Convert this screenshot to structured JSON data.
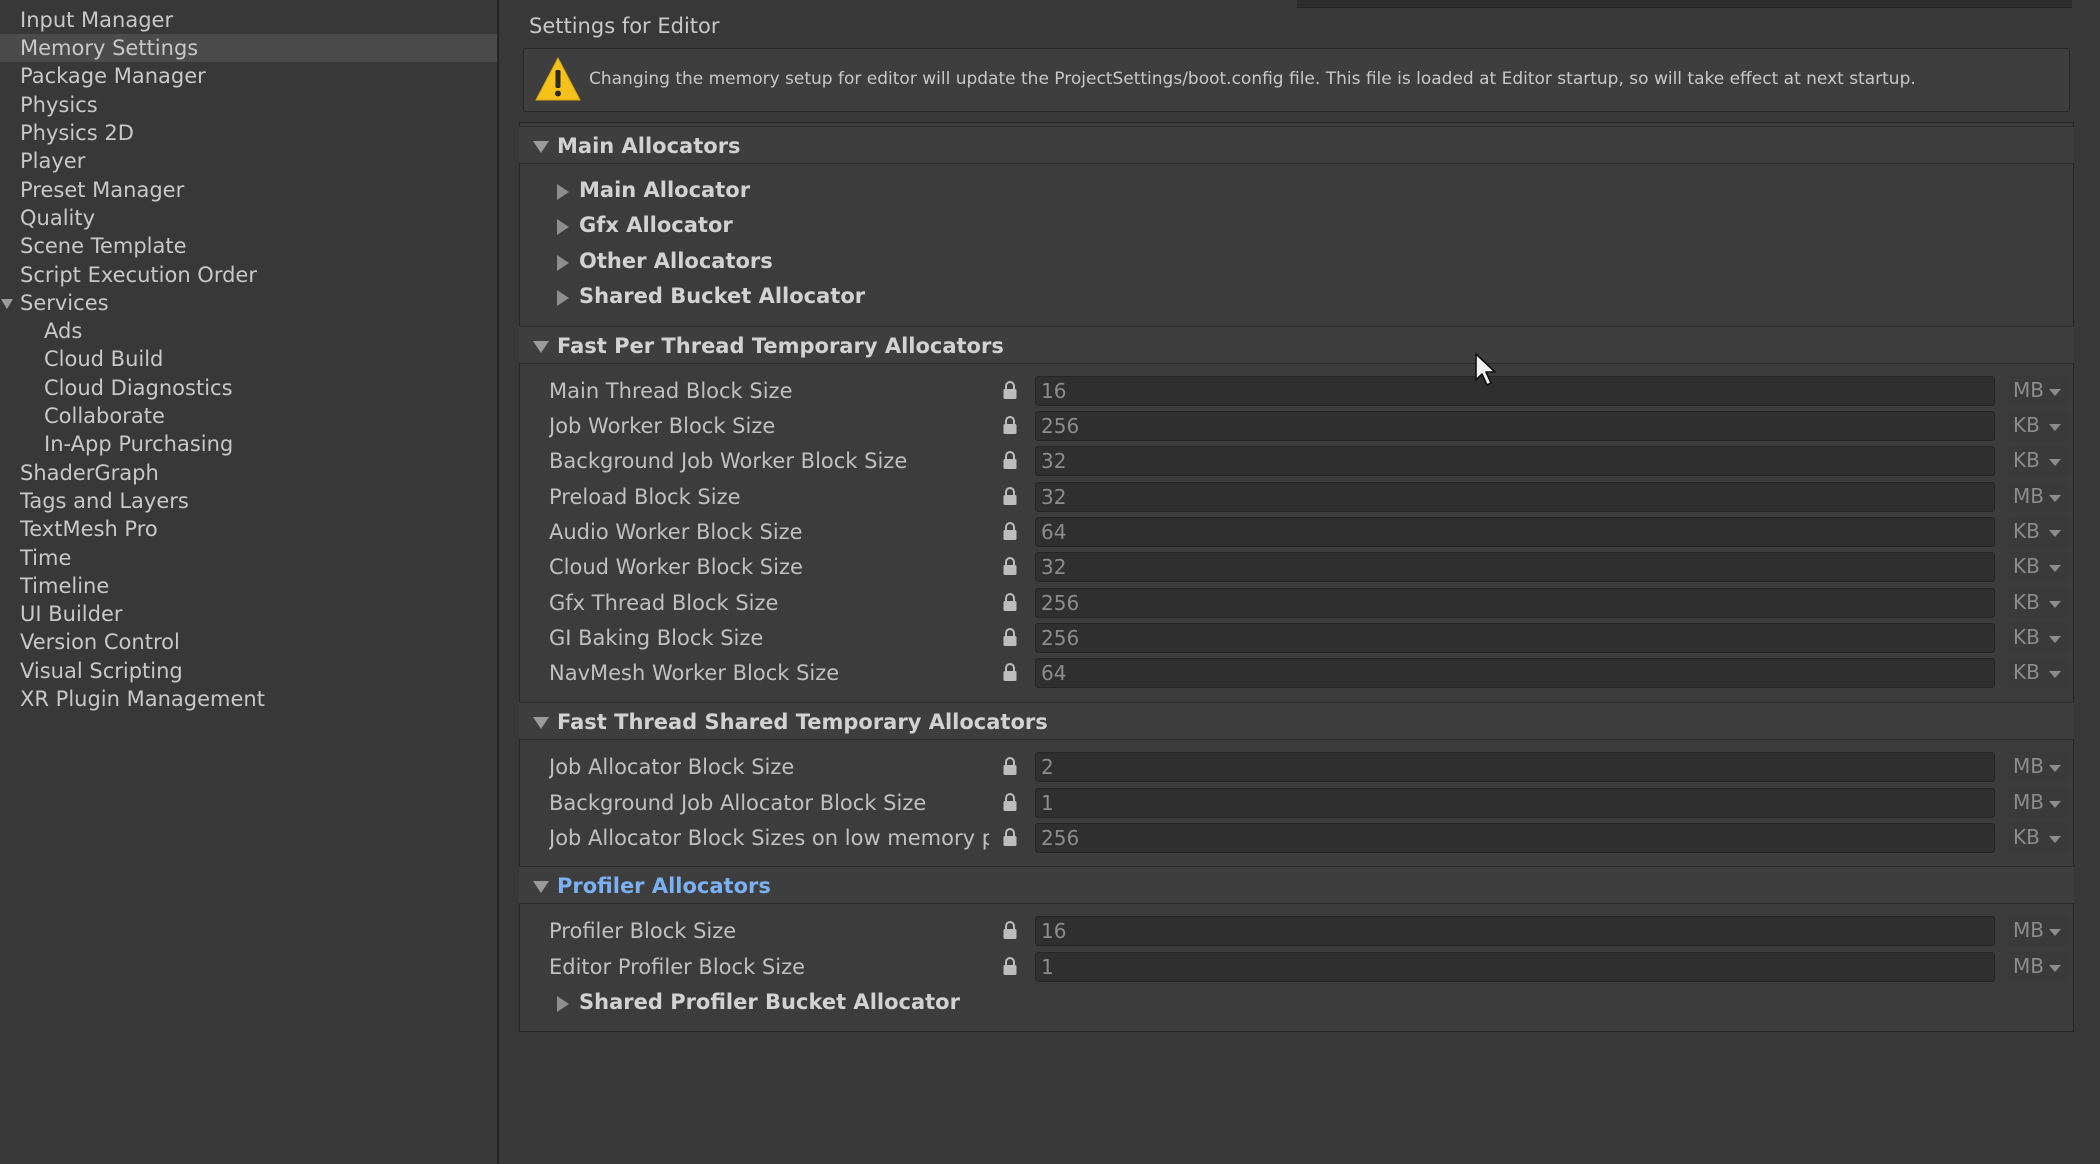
{
  "sidebar": {
    "selected": "Memory Settings",
    "items": [
      {
        "label": "Input Manager",
        "level": 0
      },
      {
        "label": "Memory Settings",
        "level": 0
      },
      {
        "label": "Package Manager",
        "level": 0
      },
      {
        "label": "Physics",
        "level": 0
      },
      {
        "label": "Physics 2D",
        "level": 0
      },
      {
        "label": "Player",
        "level": 0
      },
      {
        "label": "Preset Manager",
        "level": 0
      },
      {
        "label": "Quality",
        "level": 0
      },
      {
        "label": "Scene Template",
        "level": 0
      },
      {
        "label": "Script Execution Order",
        "level": 0
      },
      {
        "label": "Services",
        "level": 0,
        "expanded": true
      },
      {
        "label": "Ads",
        "level": 1
      },
      {
        "label": "Cloud Build",
        "level": 1
      },
      {
        "label": "Cloud Diagnostics",
        "level": 1
      },
      {
        "label": "Collaborate",
        "level": 1
      },
      {
        "label": "In-App Purchasing",
        "level": 1
      },
      {
        "label": "ShaderGraph",
        "level": 0
      },
      {
        "label": "Tags and Layers",
        "level": 0
      },
      {
        "label": "TextMesh Pro",
        "level": 0
      },
      {
        "label": "Time",
        "level": 0
      },
      {
        "label": "Timeline",
        "level": 0
      },
      {
        "label": "UI Builder",
        "level": 0
      },
      {
        "label": "Version Control",
        "level": 0
      },
      {
        "label": "Visual Scripting",
        "level": 0
      },
      {
        "label": "XR Plugin Management",
        "level": 0
      }
    ]
  },
  "main": {
    "title": "Settings for Editor",
    "warning": {
      "icon": "warning-icon",
      "text": "Changing the memory setup for editor will update the ProjectSettings/boot.config file. This file is loaded at Editor startup, so will take effect at next startup."
    },
    "sections": {
      "main_allocators": {
        "title": "Main Allocators",
        "foldouts": [
          "Main Allocator",
          "Gfx Allocator",
          "Other Allocators",
          "Shared Bucket Allocator"
        ]
      },
      "fast_per_thread": {
        "title": "Fast Per Thread Temporary Allocators",
        "rows": [
          {
            "label": "Main Thread Block Size",
            "value": "16",
            "unit": "MB"
          },
          {
            "label": "Job Worker Block Size",
            "value": "256",
            "unit": "KB"
          },
          {
            "label": "Background Job Worker Block Size",
            "value": "32",
            "unit": "KB"
          },
          {
            "label": "Preload Block Size",
            "value": "32",
            "unit": "MB"
          },
          {
            "label": "Audio Worker Block Size",
            "value": "64",
            "unit": "KB"
          },
          {
            "label": "Cloud Worker Block Size",
            "value": "32",
            "unit": "KB"
          },
          {
            "label": "Gfx Thread Block Size",
            "value": "256",
            "unit": "KB"
          },
          {
            "label": "GI Baking Block Size",
            "value": "256",
            "unit": "KB"
          },
          {
            "label": "NavMesh Worker Block Size",
            "value": "64",
            "unit": "KB"
          }
        ]
      },
      "fast_thread_shared": {
        "title": "Fast Thread Shared Temporary Allocators",
        "rows": [
          {
            "label": "Job Allocator Block Size",
            "value": "2",
            "unit": "MB"
          },
          {
            "label": "Background Job Allocator Block Size",
            "value": "1",
            "unit": "MB"
          },
          {
            "label": "Job Allocator Block Sizes on low memory pla",
            "value": "256",
            "unit": "KB"
          }
        ]
      },
      "profiler": {
        "title": "Profiler Allocators",
        "rows": [
          {
            "label": "Profiler Block Size",
            "value": "16",
            "unit": "MB"
          },
          {
            "label": "Editor Profiler Block Size",
            "value": "1",
            "unit": "MB"
          }
        ],
        "foldouts": [
          "Shared Profiler Bucket Allocator"
        ]
      }
    }
  },
  "colors": {
    "background": "#383838",
    "panel": "#3c3c3c",
    "field": "#2f2f2f",
    "selected": "#4b4b4b",
    "accent_link": "#7bb0f2",
    "warning_yellow": "#f4c21b"
  }
}
